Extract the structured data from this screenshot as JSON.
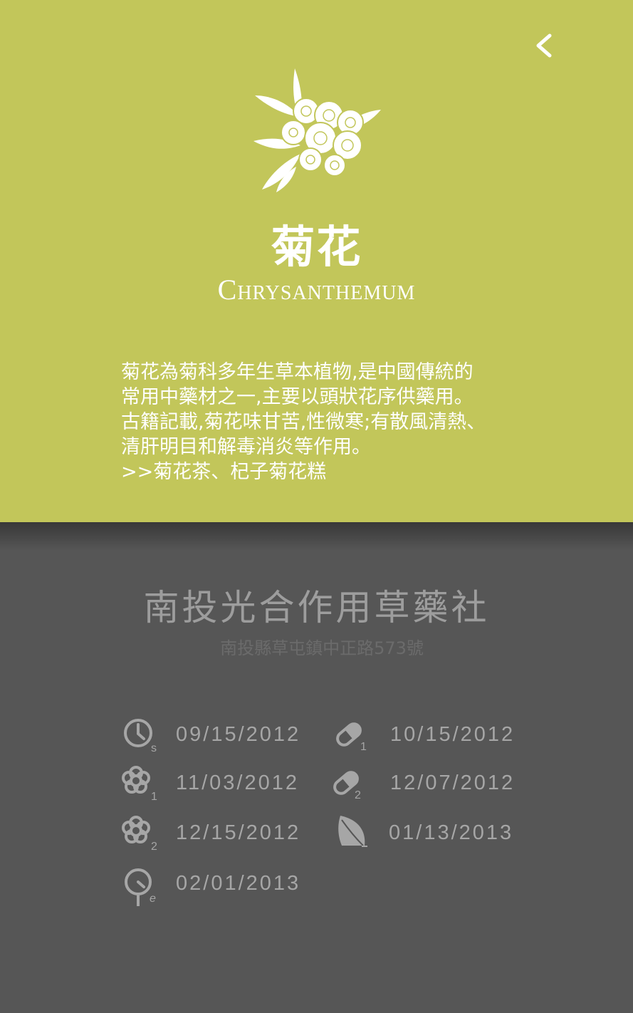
{
  "header": {
    "title_zh": "菊花",
    "title_en": "Chrysanthemum",
    "back_icon": "chevron-left-icon",
    "illustration_icon": "chrysanthemum-flower-icon"
  },
  "description": {
    "lines": [
      "菊花為菊科多年生草本植物,是中國傳統的",
      "常用中藥材之一,主要以頭狀花序供藥用。",
      "古籍記載,菊花味甘苦,性微寒;有散風清熱、",
      "清肝明目和解毒消炎等作用。",
      ">>菊花茶、杞子菊花糕"
    ]
  },
  "shop": {
    "name": "南投光合作用草藥社",
    "address": "南投縣草屯鎮中正路573號"
  },
  "timeline": [
    {
      "icon": "clock-icon",
      "subscript": "s",
      "date": "09/15/2012"
    },
    {
      "icon": "capsule-icon",
      "subscript": "1",
      "date": "10/15/2012"
    },
    {
      "icon": "flower-icon",
      "subscript": "1",
      "date": "11/03/2012"
    },
    {
      "icon": "capsule-icon",
      "subscript": "2",
      "date": "12/07/2012"
    },
    {
      "icon": "flower-icon",
      "subscript": "2",
      "date": "12/15/2012"
    },
    {
      "icon": "leaf-icon",
      "subscript": "",
      "date": "01/13/2013"
    },
    {
      "icon": "clock-end-icon",
      "subscript": "e",
      "date": "02/01/2013"
    }
  ],
  "colors": {
    "header_bg": "#c2c65a",
    "body_bg": "#565656",
    "icon_gray": "#a6a6a6",
    "text_white": "#ffffff"
  }
}
